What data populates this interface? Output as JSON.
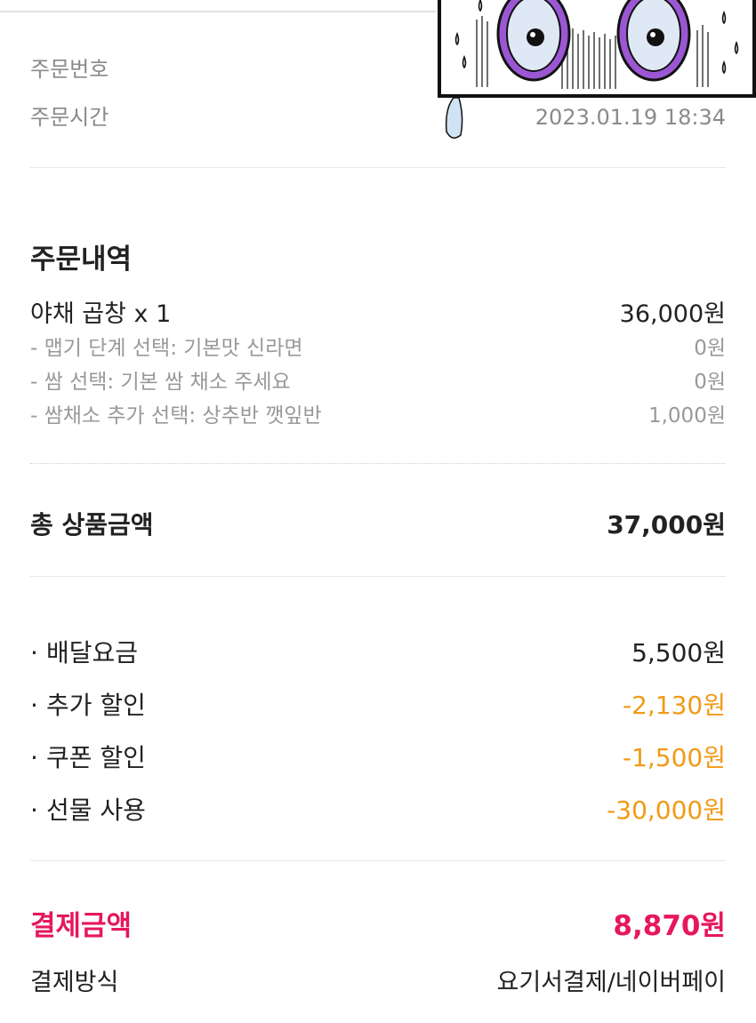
{
  "order_info": {
    "order_number_label": "주문번호",
    "order_time_label": "주문시간",
    "order_time_value": "2023.01.19 18:34"
  },
  "order_details": {
    "title": "주문내역",
    "item_name": "야채 곱창 x 1",
    "item_price": "36,000원",
    "options": [
      {
        "label": "- 맵기 단계 선택: 기본맛 신라면",
        "price": "0원"
      },
      {
        "label": "- 쌈 선택: 기본 쌈 채소 주세요",
        "price": "0원"
      },
      {
        "label": "- 쌈채소 추가 선택: 상추반 깻잎반",
        "price": "1,000원"
      }
    ]
  },
  "total_product": {
    "label": "총 상품금액",
    "value": "37,000원"
  },
  "fees": [
    {
      "bullet": "·",
      "label": "배달요금",
      "value": "5,500원"
    },
    {
      "bullet": "·",
      "label": "추가 할인",
      "value": "-2,130원"
    },
    {
      "bullet": "·",
      "label": "쿠폰 할인",
      "value": "-1,500원"
    },
    {
      "bullet": "·",
      "label": "선물 사용",
      "value": "-30,000원"
    }
  ],
  "payment": {
    "amount_label": "결제금액",
    "amount_value": "8,870원",
    "method_label": "결제방식",
    "method_value": "요기서결제/네이버페이"
  },
  "colors": {
    "discount": "#f29a16",
    "payment_accent": "#e6185b",
    "muted": "#8a8a8a"
  },
  "sticker": {
    "icon": "sweating-eyes-meme-icon"
  }
}
